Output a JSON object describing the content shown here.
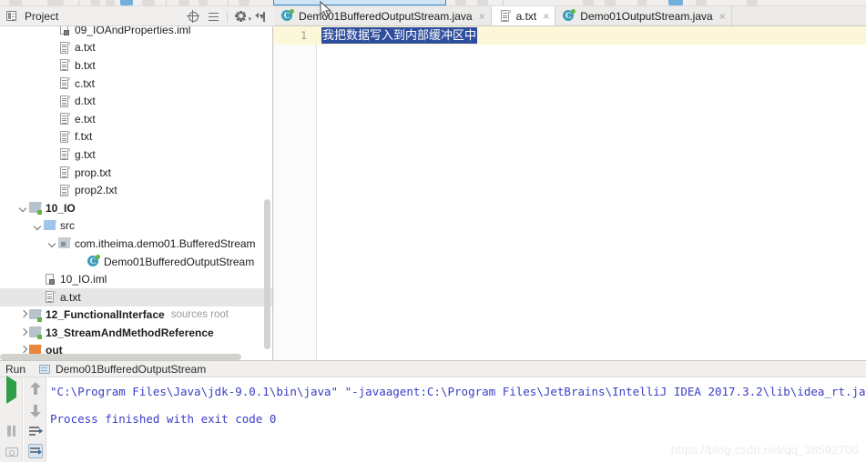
{
  "project_panel": {
    "title": "Project",
    "caret_icon": "chevron-down-icon",
    "tools": [
      {
        "name": "locate-icon",
        "title": "Select Opened File"
      },
      {
        "name": "collapse-all-icon",
        "title": "Collapse All"
      },
      {
        "name": "gear-icon",
        "title": "Settings"
      },
      {
        "name": "hide-panel-icon",
        "title": "Hide"
      }
    ]
  },
  "tree": [
    {
      "label": "09_IOAndProperties.iml",
      "icon": "iml-file-icon",
      "indent": 3,
      "arrow": "none",
      "bold": false,
      "selected": false,
      "clipped_top": true
    },
    {
      "label": "a.txt",
      "icon": "txt-file-icon",
      "indent": 3,
      "arrow": "none",
      "bold": false,
      "selected": false
    },
    {
      "label": "b.txt",
      "icon": "txt-file-icon",
      "indent": 3,
      "arrow": "none",
      "bold": false,
      "selected": false
    },
    {
      "label": "c.txt",
      "icon": "txt-file-icon",
      "indent": 3,
      "arrow": "none",
      "bold": false,
      "selected": false
    },
    {
      "label": "d.txt",
      "icon": "txt-file-icon",
      "indent": 3,
      "arrow": "none",
      "bold": false,
      "selected": false
    },
    {
      "label": "e.txt",
      "icon": "txt-file-icon",
      "indent": 3,
      "arrow": "none",
      "bold": false,
      "selected": false
    },
    {
      "label": "f.txt",
      "icon": "txt-file-icon",
      "indent": 3,
      "arrow": "none",
      "bold": false,
      "selected": false
    },
    {
      "label": "g.txt",
      "icon": "txt-file-icon",
      "indent": 3,
      "arrow": "none",
      "bold": false,
      "selected": false
    },
    {
      "label": "prop.txt",
      "icon": "txt-file-icon",
      "indent": 3,
      "arrow": "none",
      "bold": false,
      "selected": false
    },
    {
      "label": "prop2.txt",
      "icon": "txt-file-icon",
      "indent": 3,
      "arrow": "none",
      "bold": false,
      "selected": false
    },
    {
      "label": "10_IO",
      "icon": "module-folder-icon",
      "indent": 1,
      "arrow": "down",
      "bold": true,
      "selected": false
    },
    {
      "label": "src",
      "icon": "source-folder-icon",
      "indent": 2,
      "arrow": "down",
      "bold": false,
      "selected": false
    },
    {
      "label": "com.itheima.demo01.BufferedStream",
      "icon": "package-icon",
      "indent": 3,
      "arrow": "down",
      "bold": false,
      "selected": false
    },
    {
      "label": "Demo01BufferedOutputStream",
      "icon": "java-class-icon",
      "indent": 5,
      "arrow": "none",
      "bold": false,
      "selected": false
    },
    {
      "label": "10_IO.iml",
      "icon": "iml-file-icon",
      "indent": 2,
      "arrow": "none",
      "bold": false,
      "selected": false
    },
    {
      "label": "a.txt",
      "icon": "txt-file-icon",
      "indent": 2,
      "arrow": "none",
      "bold": false,
      "selected": true
    },
    {
      "label": "12_FunctionalInterface",
      "sublabel": "sources root",
      "icon": "module-folder-icon",
      "indent": 1,
      "arrow": "right",
      "bold": true,
      "selected": false
    },
    {
      "label": "13_StreamAndMethodReference",
      "icon": "module-folder-icon",
      "indent": 1,
      "arrow": "right",
      "bold": true,
      "selected": false
    },
    {
      "label": "out",
      "icon": "out-folder-icon",
      "indent": 1,
      "arrow": "right",
      "bold": true,
      "selected": false
    }
  ],
  "tabs": [
    {
      "label": "Demo01BufferedOutputStream.java",
      "icon": "java-class-icon",
      "active": false,
      "close_icon": "close-icon"
    },
    {
      "label": "a.txt",
      "icon": "txt-file-icon",
      "active": true,
      "close_icon": "close-icon"
    },
    {
      "label": "Demo01OutputStream.java",
      "icon": "java-class-icon",
      "active": false,
      "close_icon": "close-icon"
    }
  ],
  "editor": {
    "line_number": "1",
    "content": "我把数据写入到内部缓冲区中",
    "selection_color": "#2f4f9e",
    "current_line_color": "#fdf7d9"
  },
  "run_panel": {
    "title": "Run",
    "config_name": "Demo01BufferedOutputStream",
    "config_icon": "run-configuration-icon",
    "controls": [
      {
        "name": "run-button",
        "icon": "play-icon"
      },
      {
        "name": "stop-button",
        "icon": "stop-icon"
      },
      {
        "name": "pause-button",
        "icon": "pause-icon"
      },
      {
        "name": "screenshot-button",
        "icon": "camera-icon"
      },
      {
        "name": "scroll-up-button",
        "icon": "arrow-up-icon"
      },
      {
        "name": "scroll-down-button",
        "icon": "arrow-down-icon"
      },
      {
        "name": "soft-wrap-button",
        "icon": "soft-wrap-icon"
      },
      {
        "name": "scroll-to-end-button",
        "icon": "scroll-end-icon"
      }
    ],
    "console_lines": [
      "\"C:\\Program Files\\Java\\jdk-9.0.1\\bin\\java\" \"-javaagent:C:\\Program Files\\JetBrains\\IntelliJ IDEA 2017.3.2\\lib\\idea_rt.ja",
      "Process finished with exit code 0"
    ],
    "console_text_color": "#3c3cc8"
  },
  "watermark": "https://blog.csdn.net/qq_38592706"
}
